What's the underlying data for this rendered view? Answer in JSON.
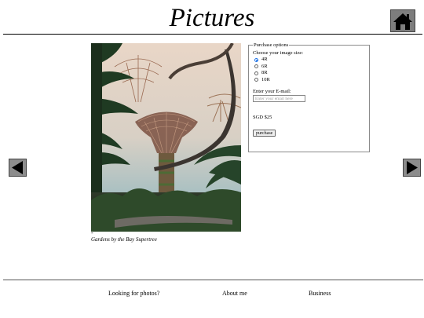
{
  "header": {
    "title": "Pictures",
    "home_icon": "home-icon"
  },
  "gallery": {
    "prev_icon": "arrow-left-icon",
    "next_icon": "arrow-right-icon",
    "bullet": "-",
    "caption": "Gardens by the Bay Supertree"
  },
  "purchase": {
    "legend": "Purchase options",
    "size_label": "Choose your image size:",
    "sizes": [
      {
        "label": "4R",
        "checked": true
      },
      {
        "label": "6R",
        "checked": false
      },
      {
        "label": "8R",
        "checked": false
      },
      {
        "label": "10R",
        "checked": false
      }
    ],
    "email_label": "Enter your E-mail:",
    "email_placeholder": "Enter your email here",
    "price": "SGD $25",
    "button_label": "purchase"
  },
  "footer": {
    "links": [
      {
        "label": "Looking for photos?"
      },
      {
        "label": "About me"
      },
      {
        "label": "Business"
      }
    ]
  }
}
